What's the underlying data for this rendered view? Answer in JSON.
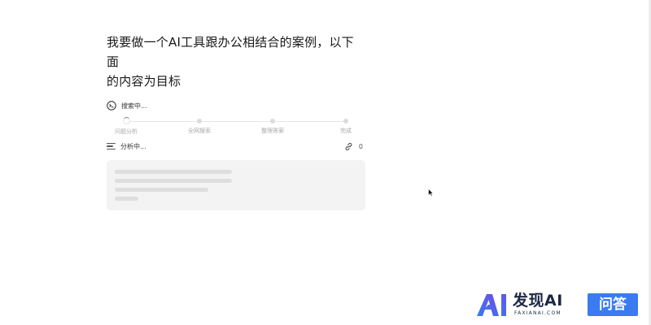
{
  "question": {
    "line1": "我要做一个AI工具跟办公相结合的案例，以下面",
    "line2": "的内容为目标"
  },
  "search": {
    "status": "搜索中..."
  },
  "steps": [
    {
      "label": "问题分析",
      "state": "active"
    },
    {
      "label": "全网搜索",
      "state": "pending"
    },
    {
      "label": "整理答案",
      "state": "pending"
    },
    {
      "label": "完成",
      "state": "pending"
    }
  ],
  "analysis": {
    "status": "分析中...",
    "source_count": "0"
  },
  "watermark": {
    "logo_text": "AI",
    "title": "发现AI",
    "subtitle": "FAXIANAI.COM",
    "badge": "问答",
    "colors": {
      "brand_blue": "#3a7bf2",
      "brand_purple": "#6b4ce6",
      "dark": "#1d2745"
    }
  }
}
